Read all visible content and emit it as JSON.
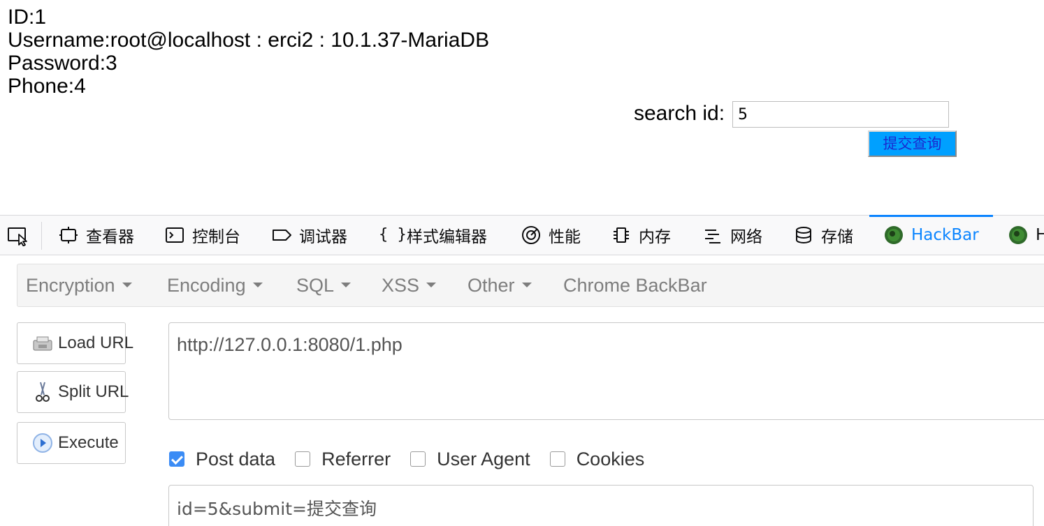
{
  "result": {
    "id_line": "ID:1",
    "username_line": "Username:root@localhost : erci2 : 10.1.37-MariaDB",
    "password_line": "Password:3",
    "phone_line": "Phone:4"
  },
  "search": {
    "label": "search id:",
    "value": "5",
    "submit_label": "提交查询"
  },
  "devtools": {
    "tabs": [
      {
        "label": "查看器",
        "icon": "inspector-icon"
      },
      {
        "label": "控制台",
        "icon": "console-icon"
      },
      {
        "label": "调试器",
        "icon": "debugger-icon"
      },
      {
        "label": "样式编辑器",
        "icon": "style-editor-icon"
      },
      {
        "label": "性能",
        "icon": "performance-icon"
      },
      {
        "label": "内存",
        "icon": "memory-icon"
      },
      {
        "label": "网络",
        "icon": "network-icon"
      },
      {
        "label": "存储",
        "icon": "storage-icon"
      },
      {
        "label": "HackBar",
        "icon": "hackbar-icon",
        "active": true
      },
      {
        "label": "H",
        "icon": "hackbar-icon"
      }
    ],
    "accent_color": "#0a84ff"
  },
  "hackbar": {
    "menu": [
      {
        "label": "Encryption",
        "dropdown": true
      },
      {
        "label": "Encoding",
        "dropdown": true
      },
      {
        "label": "SQL",
        "dropdown": true
      },
      {
        "label": "XSS",
        "dropdown": true
      },
      {
        "label": "Other",
        "dropdown": true
      },
      {
        "label": "Chrome BackBar",
        "dropdown": false
      }
    ],
    "buttons": {
      "load_url": "Load URL",
      "split_url": "Split URL",
      "execute": "Execute"
    },
    "url_value": "http://127.0.0.1:8080/1.php",
    "options": [
      {
        "label": "Post data",
        "checked": true
      },
      {
        "label": "Referrer",
        "checked": false
      },
      {
        "label": "User Agent",
        "checked": false
      },
      {
        "label": "Cookies",
        "checked": false
      }
    ],
    "post_data_value": "id=5&submit=提交查询"
  }
}
